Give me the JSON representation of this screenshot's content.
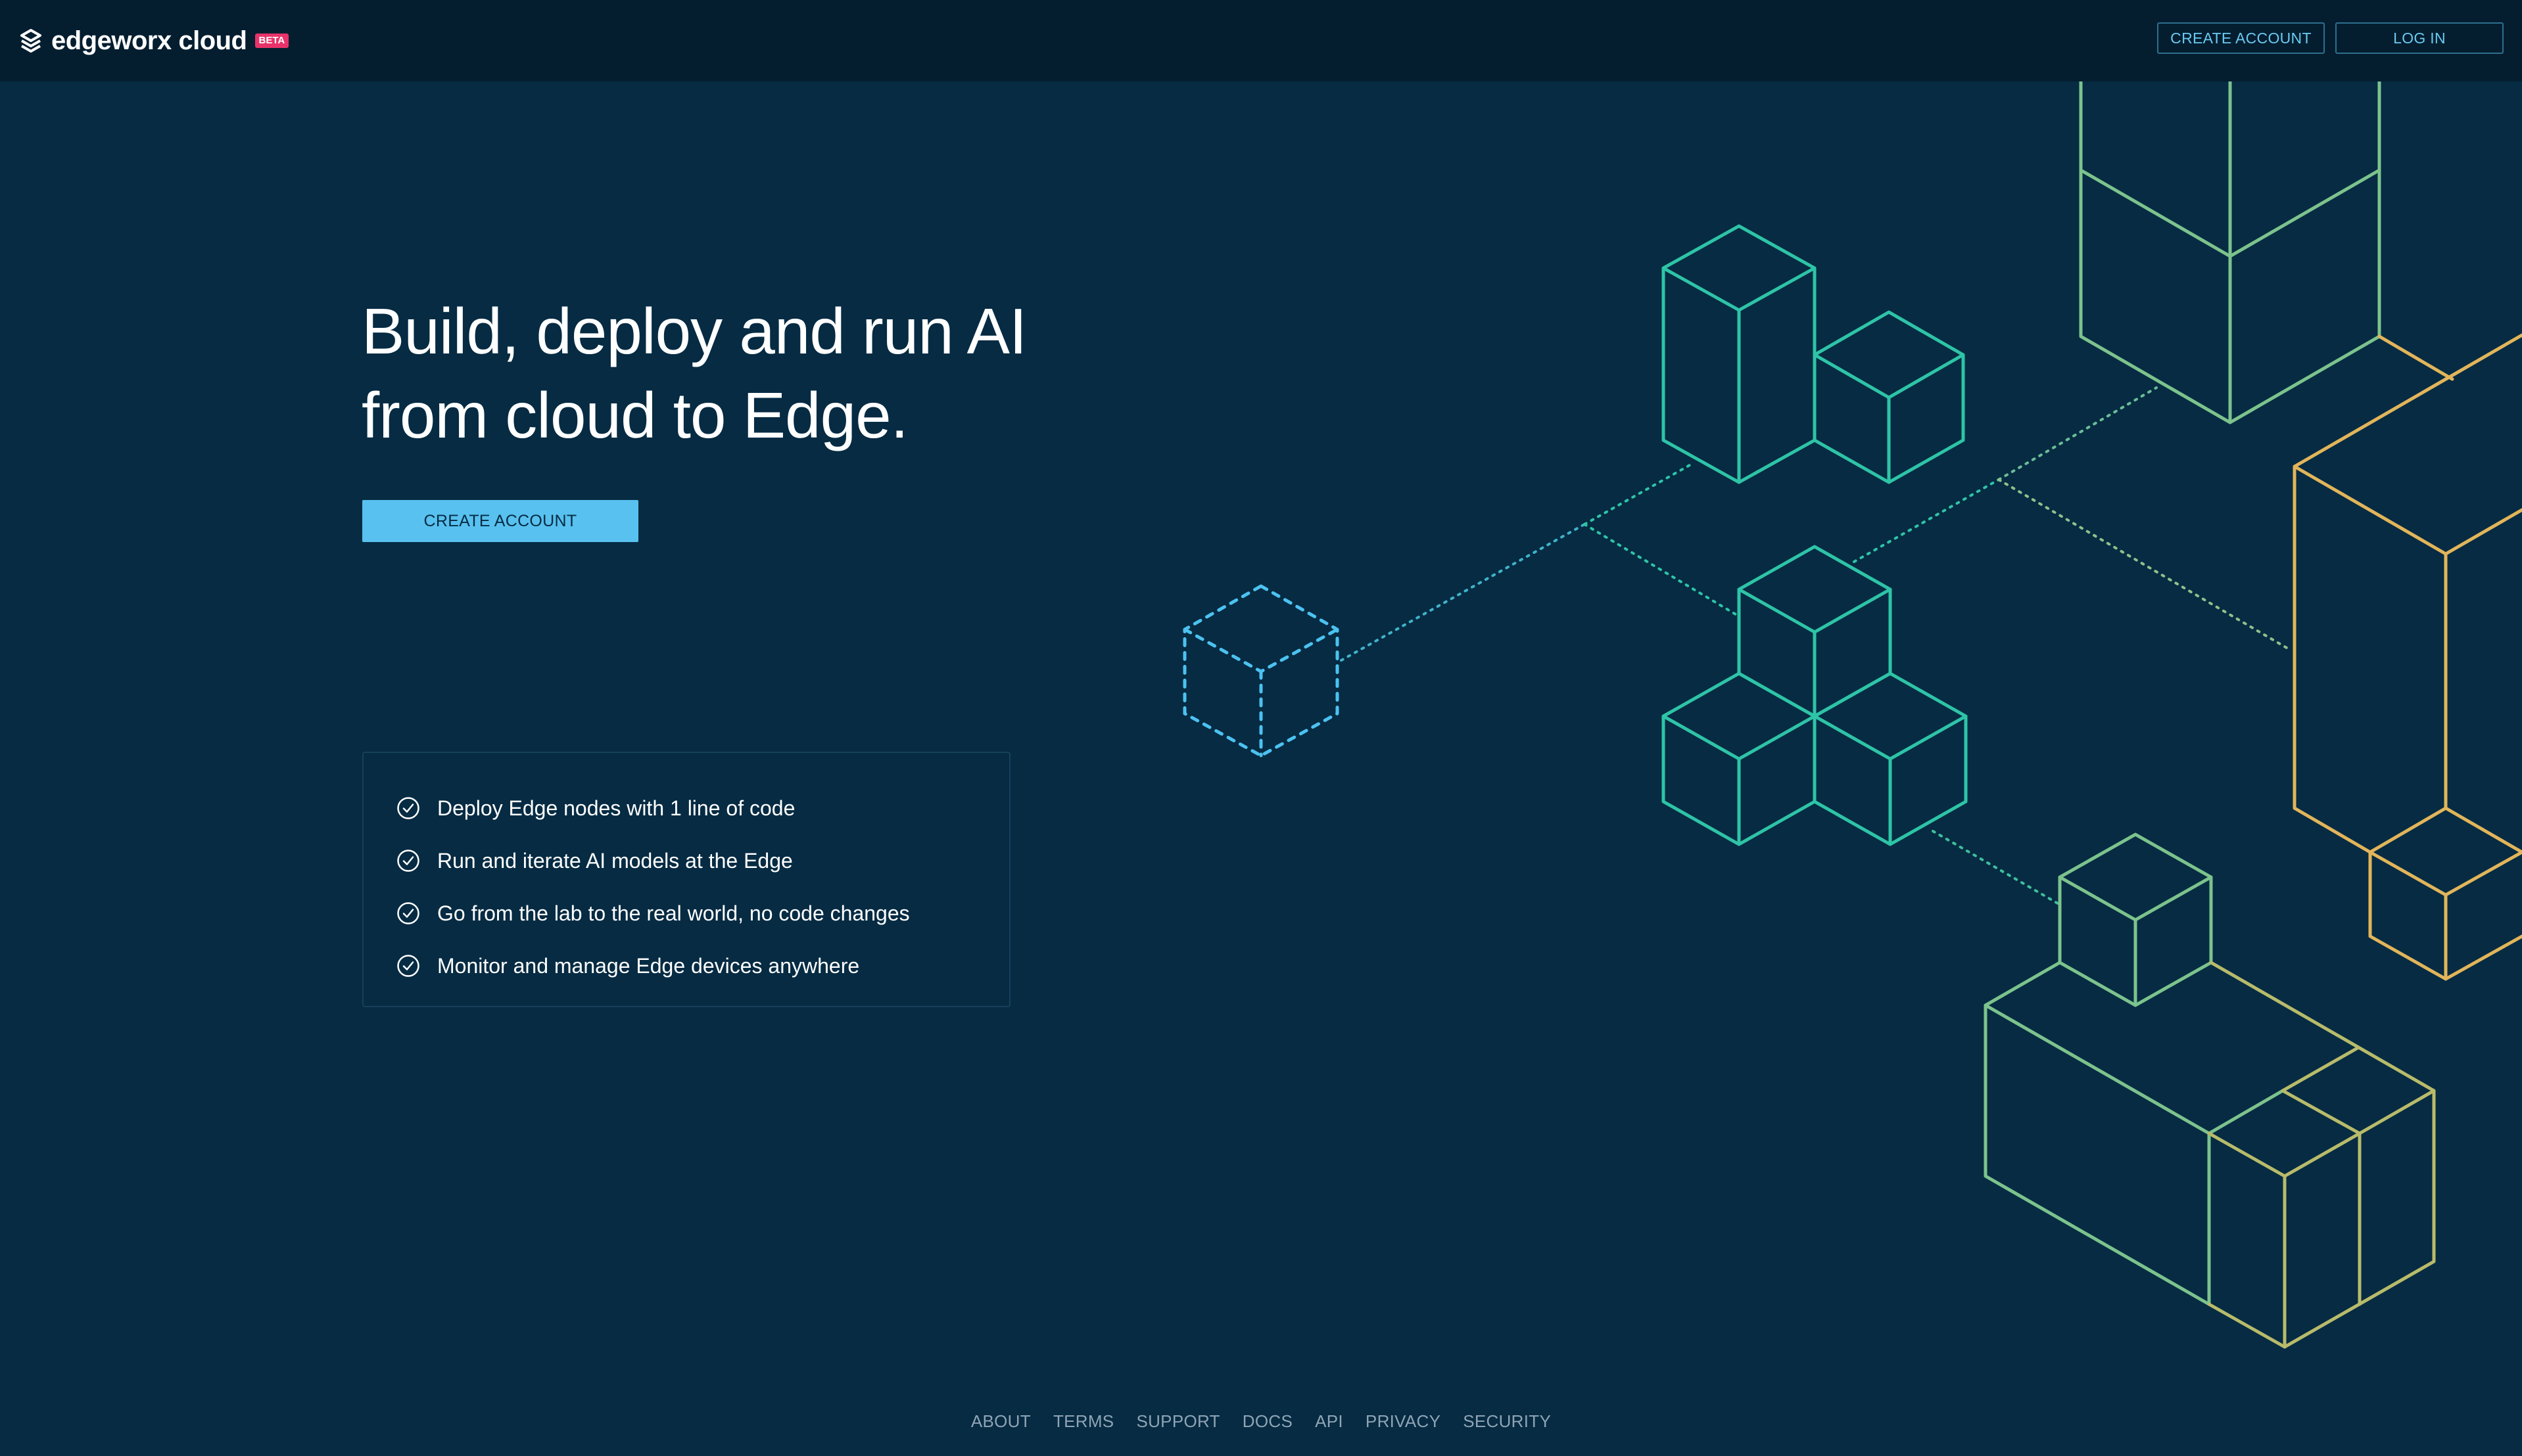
{
  "header": {
    "brand": "edgeworx cloud",
    "badge": "BETA",
    "create_account": "CREATE ACCOUNT",
    "log_in": "LOG IN"
  },
  "hero": {
    "title_line1": "Build, deploy and run AI",
    "title_line2": "from cloud to Edge.",
    "cta": "CREATE ACCOUNT"
  },
  "features": [
    "Deploy Edge nodes with 1 line of code",
    "Run and iterate AI models at the Edge",
    "Go from the lab to the real world, no code changes",
    "Monitor and manage Edge devices anywhere"
  ],
  "footer": {
    "links": [
      "ABOUT",
      "TERMS",
      "SUPPORT",
      "DOCS",
      "API",
      "PRIVACY",
      "SECURITY"
    ]
  },
  "colors": {
    "background": "#062b43",
    "header": "#041e30",
    "accent": "#58c1ef",
    "teal": "#2ec4a7",
    "green": "#7cc38c",
    "yellow": "#e2b55a",
    "badge": "#e8336a"
  },
  "icons": {
    "logo": "edgeworx-logo-icon",
    "check": "check-circle-icon"
  }
}
